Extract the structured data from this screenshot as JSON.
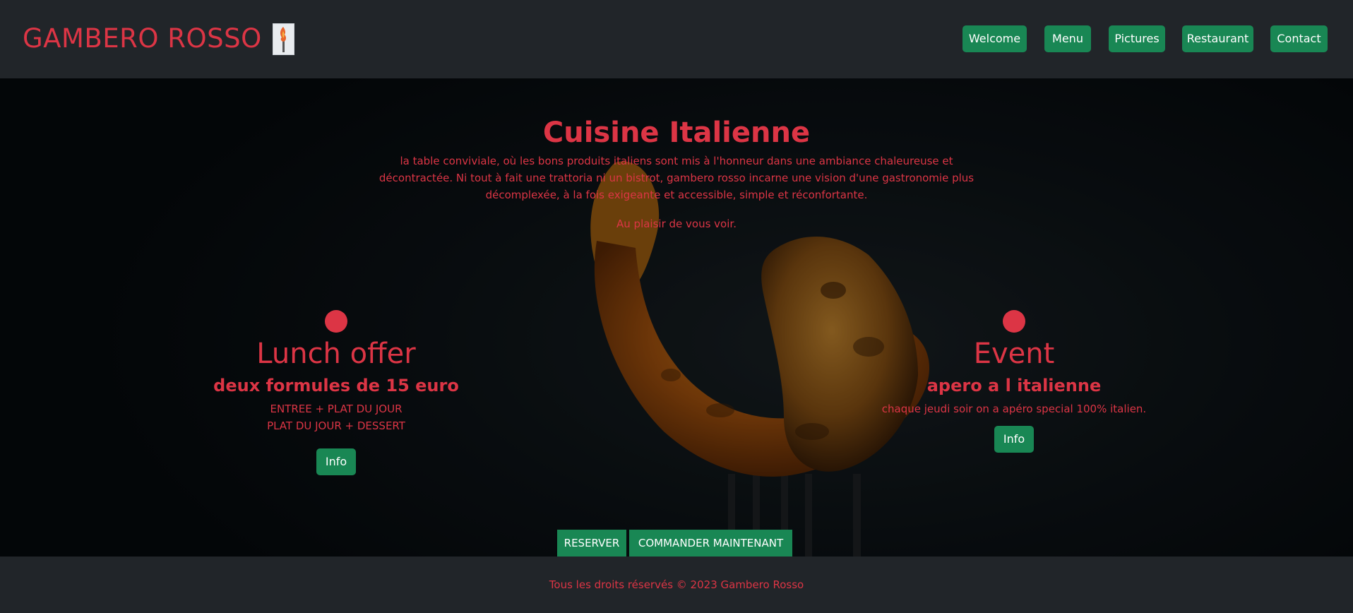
{
  "header": {
    "brand": "GAMBERO ROSSO",
    "nav": [
      "Welcome",
      "Menu",
      "Pictures",
      "Restaurant",
      "Contact"
    ]
  },
  "hero": {
    "title": "Cuisine Italienne",
    "intro": "la table conviviale, où les bons produits italiens sont mis à l'honneur dans une ambiance chaleureuse et décontractée. Ni tout à fait une trattoria ni un bistrot, gambero rosso incarne une vision d'une gastronomie plus décomplexée, à la fois exigeante et accessible, simple et réconfortante.",
    "closing": "Au plaisir de vous voir."
  },
  "lunch": {
    "title": "Lunch offer",
    "subtitle": "deux formules de 15 euro",
    "line1": "ENTREE + PLAT DU JOUR",
    "line2": "PLAT DU JOUR + DESSERT",
    "button": "Info"
  },
  "event": {
    "title": "Event",
    "subtitle": "apero a l italienne",
    "text": "chaque jeudi soir on a apéro special 100% italien.",
    "button": "Info"
  },
  "cta": {
    "reserve": "RESERVER",
    "order": "COMMANDER MAINTENANT"
  },
  "footer": {
    "text": "Tous les droits réservés © 2023 Gambero Rosso"
  },
  "colors": {
    "accent": "#dc3545",
    "button": "#198754",
    "navbar": "#212529"
  },
  "icons": {
    "logo": "shrimp-torch-logo",
    "background": "shrimp-on-fork-photo"
  }
}
